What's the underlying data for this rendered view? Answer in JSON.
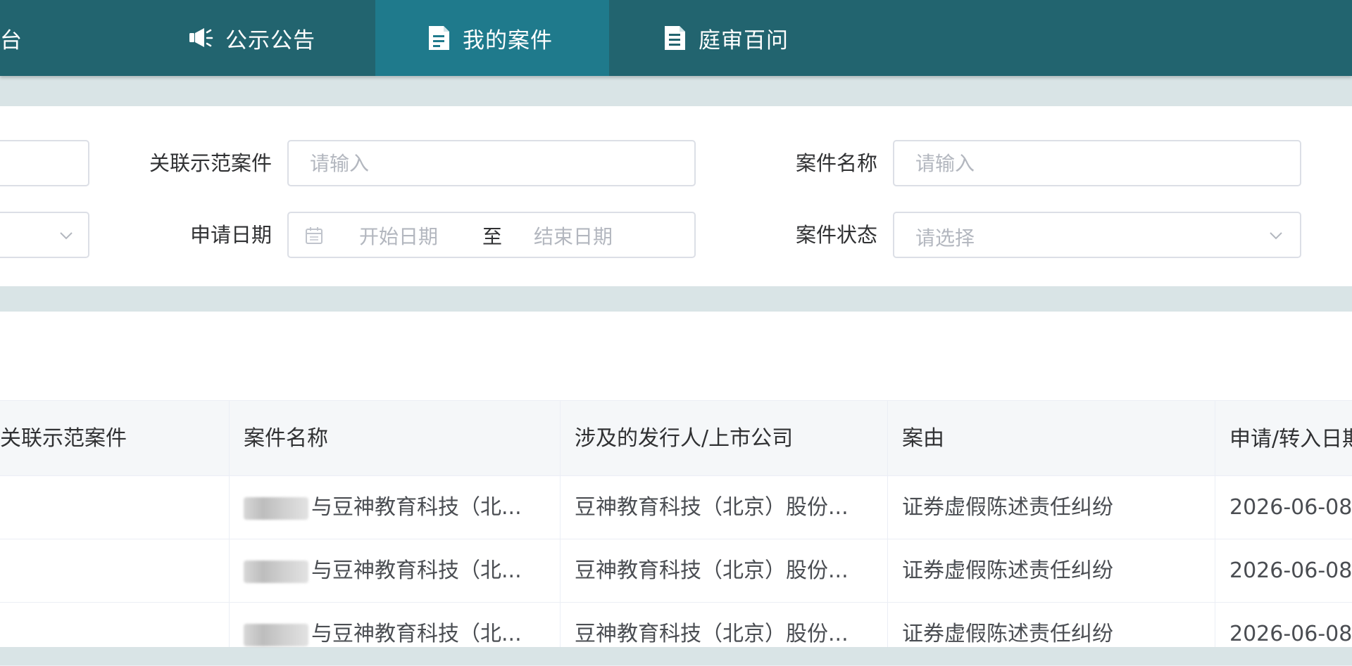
{
  "nav": {
    "items": [
      {
        "label": "台",
        "icon": "dashboard-icon"
      },
      {
        "label": "公示公告",
        "icon": "megaphone-icon"
      },
      {
        "label": "我的案件",
        "icon": "document-icon",
        "active": true
      },
      {
        "label": "庭审百问",
        "icon": "document-list-icon"
      }
    ]
  },
  "filters": {
    "related_case_label": "关联示范案件",
    "related_case_placeholder": "请输入",
    "case_name_label": "案件名称",
    "case_name_placeholder": "请输入",
    "apply_date_label": "申请日期",
    "start_date_placeholder": "开始日期",
    "date_separator": "至",
    "end_date_placeholder": "结束日期",
    "case_status_label": "案件状态",
    "case_status_placeholder": "请选择"
  },
  "table": {
    "columns": [
      "关联示范案件",
      "案件名称",
      "涉及的发行人/上市公司",
      "案由",
      "申请/转入日期"
    ],
    "rows": [
      {
        "related": "",
        "name": "与豆神教育科技（北...",
        "company": "豆神教育科技（北京）股份...",
        "cause": "证券虚假陈述责任纠纷",
        "date": "2026-06-08"
      },
      {
        "related": "",
        "name": "与豆神教育科技（北...",
        "company": "豆神教育科技（北京）股份...",
        "cause": "证券虚假陈述责任纠纷",
        "date": "2026-06-08"
      },
      {
        "related": "",
        "name": "与豆神教育科技（北...",
        "company": "豆神教育科技（北京）股份...",
        "cause": "证券虚假陈述责任纠纷",
        "date": "2026-06-08"
      }
    ]
  },
  "colors": {
    "nav_bg": "#22646f",
    "nav_active": "#1f7a8c"
  }
}
